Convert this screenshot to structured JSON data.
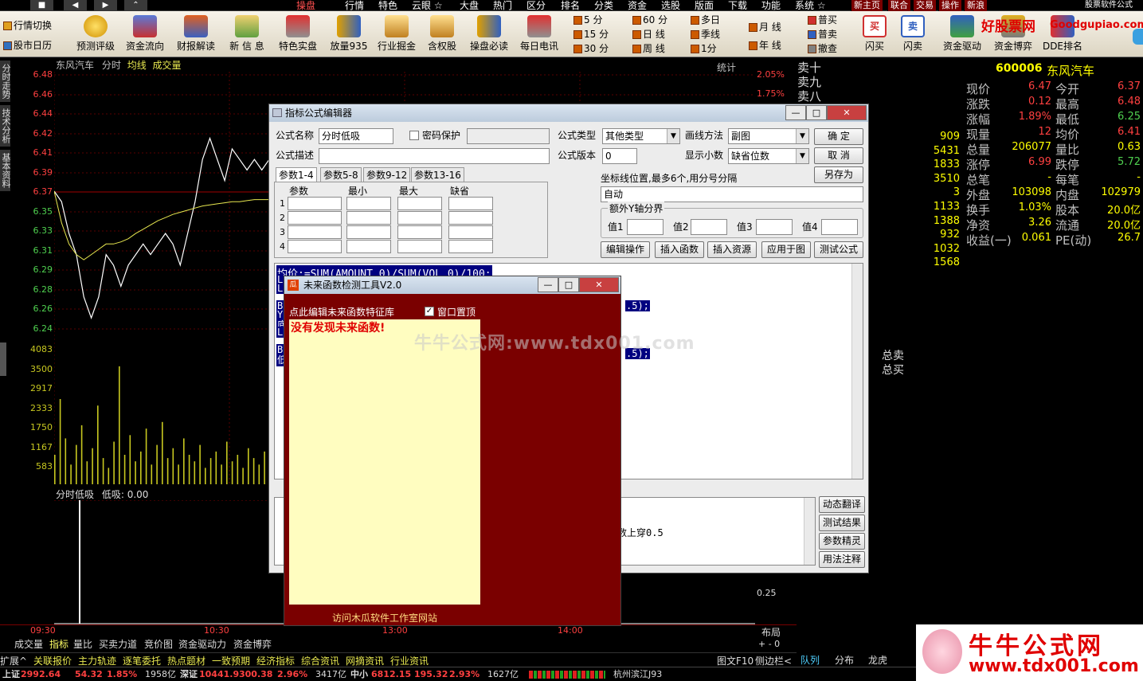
{
  "menubar": {
    "items": [
      "操盘",
      "行情",
      "特色",
      "云眼 ☆",
      "大盘",
      "热门",
      "区分",
      "排名",
      "分类",
      "资金",
      "选股",
      "版面",
      "下载",
      "功能",
      "系统 ☆"
    ],
    "right": [
      "新主页",
      "联合",
      "交易",
      "操作",
      "新浪"
    ],
    "brand": "股票软件公式"
  },
  "toolbar": {
    "left_top": "行情切换",
    "left_bottom": "股市日历",
    "buttons": [
      "预测评级",
      "资金流向",
      "财报解读",
      "新 信 息",
      "特色实盘",
      "放量935",
      "行业掘金",
      "含权股",
      "操盘必读",
      "每日电讯"
    ],
    "periods": [
      [
        "5 分",
        "15 分",
        "30 分"
      ],
      [
        "60 分",
        "日 线",
        "周 线"
      ],
      [
        "多日",
        "季线",
        "1分"
      ],
      [
        "月 线",
        "年 线"
      ]
    ],
    "trade": [
      "普买",
      "普卖",
      "撤查"
    ],
    "buttons2": [
      "闪买",
      "闪卖",
      "资金驱动",
      "资金博弈",
      "DDE排名"
    ],
    "logo": "好股票网",
    "logo2": "Goodgupiao.com"
  },
  "chart": {
    "stock": "东风汽车",
    "mode": "分时",
    "avg": "均线",
    "vol": "成交量",
    "stat": "统计",
    "price_labels": [
      "6.48",
      "6.46",
      "6.44",
      "6.42",
      "6.41",
      "6.39",
      "6.37",
      "6.35",
      "6.33",
      "6.31",
      "6.29",
      "6.28",
      "6.26",
      "6.24"
    ],
    "vol_labels": [
      "4083",
      "3500",
      "2917",
      "2333",
      "1750",
      "1167",
      "583"
    ],
    "pct_labels": [
      "2.05%",
      "1.75%"
    ],
    "indicator": "分时低吸",
    "indicator_value": "低吸: 0.00",
    "indicator_right": "0.25",
    "times": [
      "09:30",
      "10:30",
      "13:00",
      "14:00"
    ],
    "layout_btn": "布局",
    "side_tabs": [
      "分时走势",
      "技术分析",
      "基本资料"
    ]
  },
  "orderbook": {
    "sell_labels": [
      "卖十",
      "卖九",
      "卖八"
    ],
    "values": [
      "909",
      "5431",
      "1833",
      "3510",
      "3",
      "1133",
      "1388",
      "932",
      "1032",
      "1568"
    ],
    "total_sell": "总卖",
    "total_buy": "总买"
  },
  "quotes": {
    "code": "600006",
    "name": "东风汽车",
    "rows": [
      [
        "现价",
        "6.47",
        "今开",
        "6.37"
      ],
      [
        "涨跌",
        "0.12",
        "最高",
        "6.48"
      ],
      [
        "涨幅",
        "1.89%",
        "最低",
        "6.25"
      ],
      [
        "现量",
        "12",
        "均价",
        "6.41"
      ],
      [
        "总量",
        "206077",
        "量比",
        "0.63"
      ],
      [
        "涨停",
        "6.99",
        "跌停",
        "5.72"
      ],
      [
        "总笔",
        "-",
        "每笔",
        "-"
      ],
      [
        "外盘",
        "103098",
        "内盘",
        "102979"
      ],
      [
        "换手",
        "1.03%",
        "股本",
        "20.0亿"
      ],
      [
        "净资",
        "3.26",
        "流通",
        "20.0亿"
      ],
      [
        "收益(一)",
        "0.061",
        "PE(动)",
        "26.7"
      ]
    ]
  },
  "editor": {
    "title": "指标公式编辑器",
    "name_label": "公式名称",
    "name_value": "分时低吸",
    "pwd_label": "密码保护",
    "desc_label": "公式描述",
    "type_label": "公式类型",
    "type_value": "其他类型",
    "draw_label": "画线方法",
    "draw_value": "副图",
    "version_label": "公式版本",
    "version_value": "0",
    "decimal_label": "显示小数",
    "decimal_value": "缺省位数",
    "ok": "确 定",
    "cancel": "取 消",
    "saveas": "另存为",
    "tabs": [
      "参数1-4",
      "参数5-8",
      "参数9-12",
      "参数13-16"
    ],
    "param_headers": [
      "参数",
      "最小",
      "最大",
      "缺省"
    ],
    "axis_label": "坐标线位置,最多6个,用分号分隔",
    "axis_value": "自动",
    "extra_label": "额外Y轴分界",
    "vals": [
      "值1",
      "值2",
      "值3",
      "值4"
    ],
    "actions": [
      "编辑操作",
      "插入函数",
      "插入资源",
      "应用于图",
      "测试公式"
    ],
    "code_lines": [
      "均价:=SUM(AMOUNT,0)/SUM(VOL,0)/100;",
      "L",
      "L",
      ".5);",
      "B",
      "Y",
      "底",
      "L",
      ".5);",
      "B",
      "低"
    ],
    "side_buttons": [
      "动态翻译",
      "测试结果",
      "参数精灵",
      "用法注释"
    ],
    "lower_text": "数上穿0.5"
  },
  "tool": {
    "title": "未来函数检测工具V2.0",
    "edit_link": "点此编辑未来函数特征库",
    "topmost": "窗口置顶",
    "result": "没有发现未来函数!",
    "visit": "访问木瓜软件工作室网站"
  },
  "watermark": "牛牛公式网:www.tdx001.com",
  "bottom_tabs": [
    "成交量",
    "指标",
    "量比",
    "买卖力道",
    "竞价图",
    "资金驱动力",
    "资金博弈"
  ],
  "bottom_right": [
    "队列",
    "分布",
    "龙虎"
  ],
  "ticker": [
    "扩展^",
    "关联报价",
    "主力轨迹",
    "逐笔委托",
    "热点题材",
    "一致预期",
    "经济指标",
    "综合资讯",
    "网摘资讯",
    "行业资讯"
  ],
  "ticker_right": [
    "图文F10",
    "侧边栏<"
  ],
  "status": {
    "sh_label": "上证",
    "sh": "2992.64",
    "sh_chg": "54.32",
    "sh_pct": "1.85%",
    "sh_amt": "1958亿",
    "sz_label": "深证",
    "sz": "10441.9",
    "sz_chg": "300.38",
    "sz_pct": "2.96%",
    "sz_amt": "3417亿",
    "zx_label": "中小",
    "zx": "6812.15",
    "zx_chg": "195.32",
    "zx_pct": "2.93%",
    "zx_amt": "1627亿",
    "site": "杭州滨江J93"
  },
  "brand_logo": {
    "top": "牛牛公式网",
    "bottom": "www.tdx001.com"
  },
  "colors": {
    "up": "#ff4040",
    "down": "#4fd04f",
    "avg": "#e8e850",
    "dialog_bg": "#7a0000"
  },
  "price_series": [
    6.37,
    6.36,
    6.33,
    6.31,
    6.27,
    6.25,
    6.27,
    6.31,
    6.3,
    6.28,
    6.3,
    6.31,
    6.32,
    6.31,
    6.32,
    6.33,
    6.32,
    6.3,
    6.33,
    6.36,
    6.4,
    6.42,
    6.4,
    6.38,
    6.41,
    6.4,
    6.39,
    6.4,
    6.39,
    6.4
  ],
  "avg_series": [
    6.37,
    6.34,
    6.32,
    6.31,
    6.305,
    6.31,
    6.315,
    6.32,
    6.32,
    6.322,
    6.325,
    6.33,
    6.334,
    6.338,
    6.342,
    6.345,
    6.348,
    6.35,
    6.352,
    6.354,
    6.356,
    6.357,
    6.358,
    6.359,
    6.36,
    6.36,
    6.361,
    6.362,
    6.362,
    6.362
  ],
  "vol_series": [
    900,
    2600,
    1400,
    600,
    1200,
    1800,
    700,
    1100,
    2400,
    800,
    500,
    1300,
    3600,
    900,
    1500,
    700,
    1000,
    1700,
    600,
    1200,
    1900,
    800,
    1100,
    600,
    1400,
    900,
    700,
    1200,
    500,
    800,
    1000,
    600,
    1300,
    700,
    900,
    500,
    1100,
    800,
    600,
    1000
  ]
}
